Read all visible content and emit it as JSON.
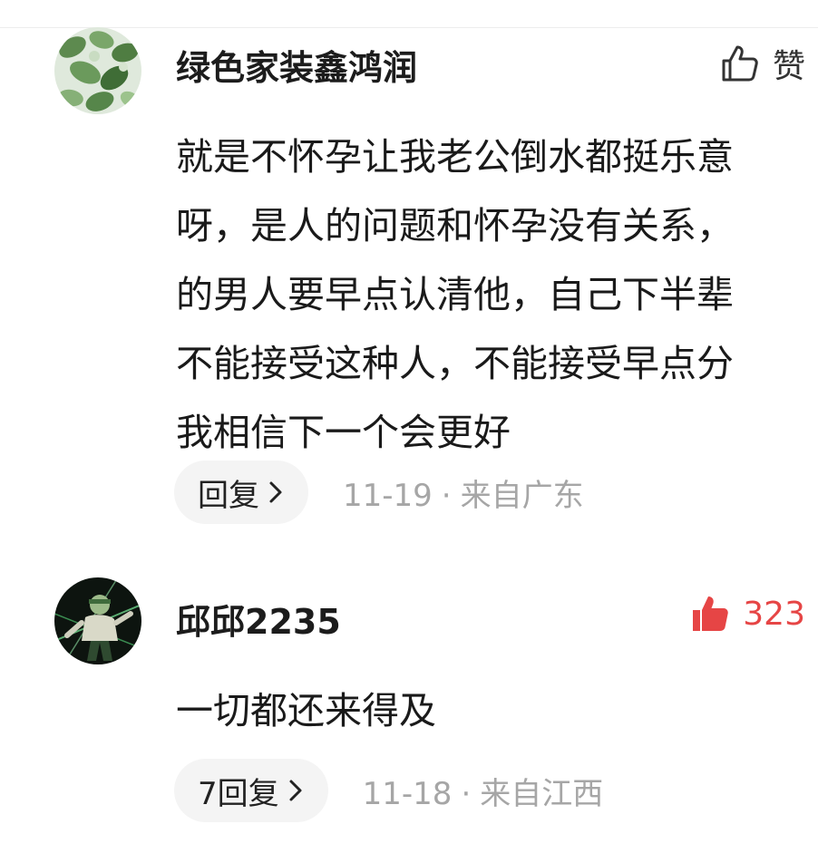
{
  "comments": [
    {
      "username": "绿色家装鑫鸿润",
      "like_label": "赞",
      "liked": false,
      "avatar_icon": "leaves-avatar",
      "lines": [
        "就是不怀孕让我老公倒水都挺乐意",
        "呀，是人的问题和怀孕没有关系，",
        "的男人要早点认清他，自己下半辈",
        "不能接受这种人，不能接受早点分",
        "我相信下一个会更好"
      ],
      "reply_label": "回复",
      "date": "11-19",
      "separator": "·",
      "location": "来自广东"
    },
    {
      "username": "邱邱2235",
      "like_label": "323",
      "liked": true,
      "avatar_icon": "character-avatar",
      "lines": [
        "一切都还来得及"
      ],
      "reply_label": "7回复",
      "date": "11-18",
      "separator": "·",
      "location": "来自江西"
    }
  ],
  "colors": {
    "liked": "#e64545",
    "meta": "#a6a6a6",
    "pill_bg": "#f4f4f4"
  }
}
